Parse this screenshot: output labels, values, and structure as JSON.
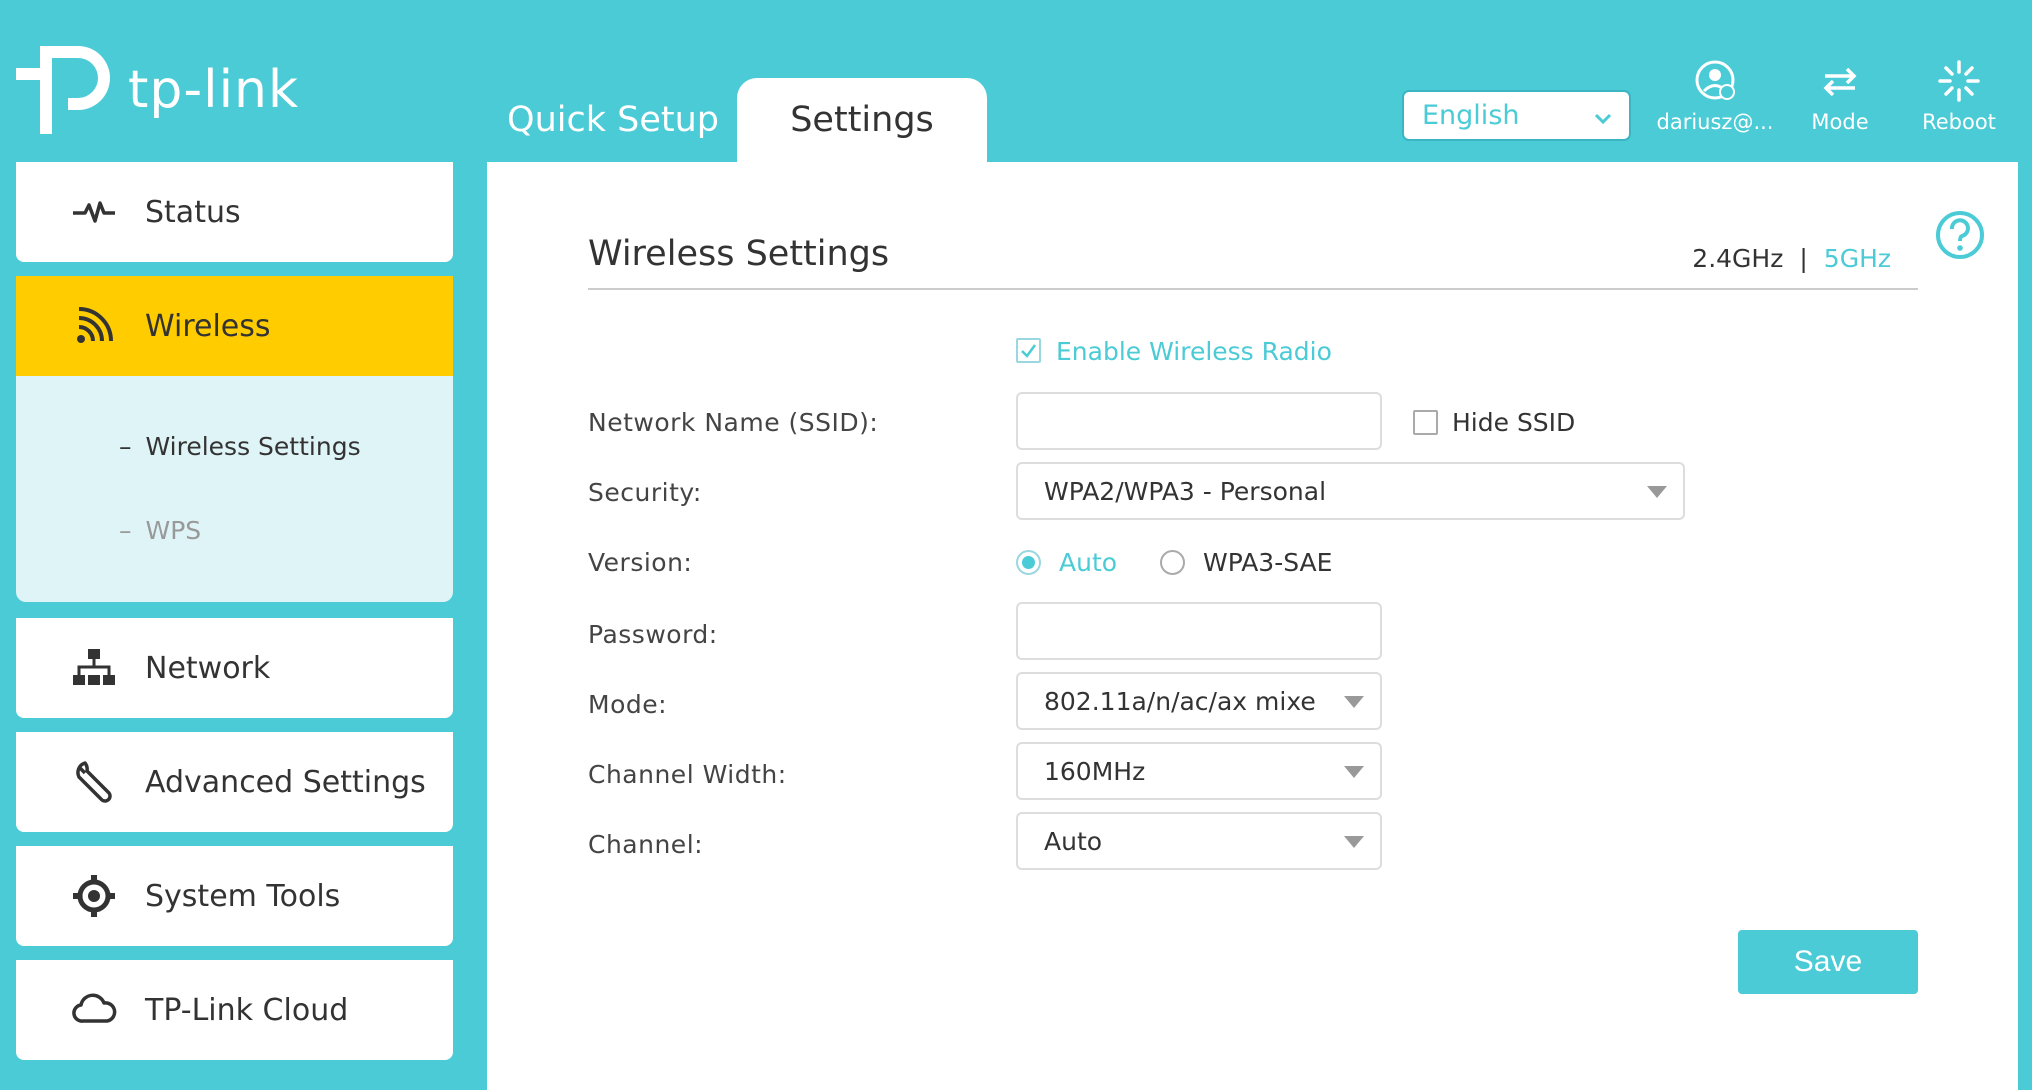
{
  "brand": {
    "name": "tp-link"
  },
  "tabs": [
    {
      "label": "Quick Setup",
      "active": false
    },
    {
      "label": "Settings",
      "active": true
    }
  ],
  "header": {
    "language": "English",
    "user_label": "dariusz@...",
    "mode_label": "Mode",
    "reboot_label": "Reboot"
  },
  "sidebar": {
    "items": [
      {
        "label": "Status",
        "icon": "pulse-icon"
      },
      {
        "label": "Wireless",
        "icon": "wifi-icon",
        "active": true
      },
      {
        "label": "Network",
        "icon": "network-icon"
      },
      {
        "label": "Advanced Settings",
        "icon": "wrench-icon"
      },
      {
        "label": "System Tools",
        "icon": "gear-icon"
      },
      {
        "label": "TP-Link Cloud",
        "icon": "cloud-icon"
      }
    ],
    "submenu": [
      {
        "label": "Wireless Settings",
        "active": true
      },
      {
        "label": "WPS",
        "active": false
      }
    ]
  },
  "main": {
    "title": "Wireless Settings",
    "band_24": "2.4GHz",
    "band_sep": "|",
    "band_5": "5GHz",
    "enable_radio_label": "Enable Wireless Radio",
    "enable_radio_checked": true,
    "fields": {
      "ssid_label": "Network Name (SSID):",
      "ssid_value": "",
      "hide_ssid_label": "Hide SSID",
      "hide_ssid_checked": false,
      "security_label": "Security:",
      "security_value": "WPA2/WPA3 - Personal",
      "version_label": "Version:",
      "version_options": [
        "Auto",
        "WPA3-SAE"
      ],
      "version_selected": "Auto",
      "password_label": "Password:",
      "password_value": "",
      "mode_label": "Mode:",
      "mode_value": "802.11a/n/ac/ax mixe",
      "channel_width_label": "Channel Width:",
      "channel_width_value": "160MHz",
      "channel_label": "Channel:",
      "channel_value": "Auto"
    },
    "save_label": "Save"
  },
  "colors": {
    "accent": "#4acbd6",
    "active_nav": "#ffcc00",
    "submenu_bg": "#def4f7"
  }
}
